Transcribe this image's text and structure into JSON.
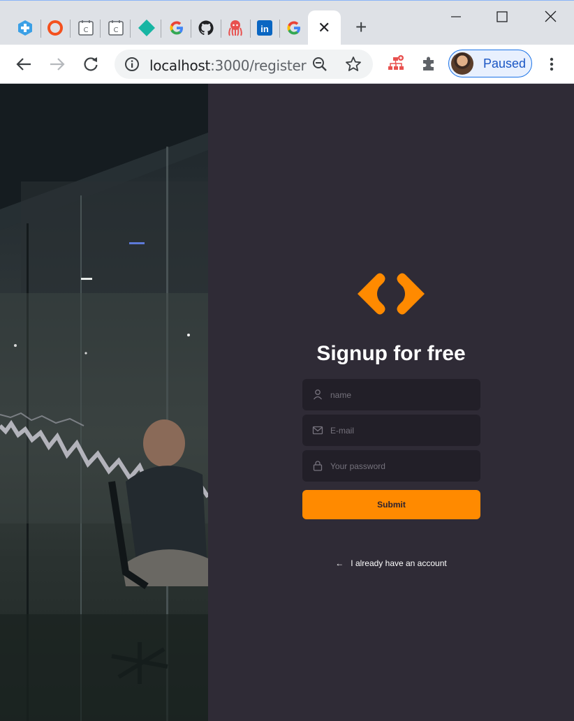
{
  "browser": {
    "url_host": "localhost",
    "url_path": ":3000/register",
    "profile_status": "Paused",
    "new_tab_symbol": "+",
    "close_tab_symbol": "✕",
    "tabs": [
      {
        "icon": "medical-cross-icon"
      },
      {
        "icon": "orange-ring-icon"
      },
      {
        "icon": "page-c-icon",
        "letter": "C"
      },
      {
        "icon": "page-c-icon",
        "letter": "C"
      },
      {
        "icon": "teal-diamond-icon"
      },
      {
        "icon": "google-icon"
      },
      {
        "icon": "github-icon"
      },
      {
        "icon": "octopus-icon"
      },
      {
        "icon": "linkedin-icon",
        "letter": "in"
      },
      {
        "icon": "google-icon"
      },
      {
        "icon": "active-tab",
        "active": true
      }
    ]
  },
  "page": {
    "heading": "Signup for free",
    "name_placeholder": "name",
    "email_placeholder": "E-mail",
    "password_placeholder": "Your password",
    "submit_label": "Submit",
    "account_link": "I already have an account",
    "account_arrow": "←",
    "accent_color": "#ff8a00",
    "panel_color": "#2f2b36",
    "field_color": "#221f28"
  }
}
